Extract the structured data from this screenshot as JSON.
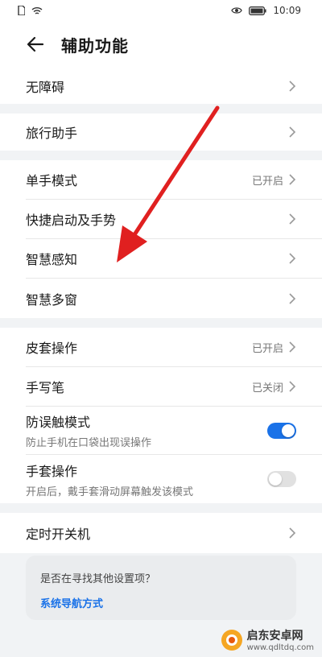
{
  "status_bar": {
    "time": "10:09"
  },
  "header": {
    "title": "辅助功能"
  },
  "groups": [
    {
      "items": [
        {
          "label": "无障碍"
        }
      ]
    },
    {
      "items": [
        {
          "label": "旅行助手"
        }
      ]
    },
    {
      "items": [
        {
          "label": "单手模式",
          "status": "已开启"
        },
        {
          "label": "快捷启动及手势"
        },
        {
          "label": "智慧感知"
        },
        {
          "label": "智慧多窗"
        }
      ]
    },
    {
      "items": [
        {
          "label": "皮套操作",
          "status": "已开启"
        },
        {
          "label": "手写笔",
          "status": "已关闭"
        },
        {
          "label": "防误触模式",
          "sub": "防止手机在口袋出现误操作",
          "toggle": true
        },
        {
          "label": "手套操作",
          "sub": "开启后，戴手套滑动屏幕触发该模式",
          "toggle": false
        }
      ]
    },
    {
      "items": [
        {
          "label": "定时开关机"
        }
      ]
    }
  ],
  "suggestion": {
    "question": "是否在寻找其他设置项？",
    "link": "系统导航方式"
  },
  "watermark": {
    "name": "启东安卓网",
    "url": "www.qdltdq.com"
  },
  "colors": {
    "accent": "#1a72e8",
    "annotation_arrow": "#e02020"
  }
}
